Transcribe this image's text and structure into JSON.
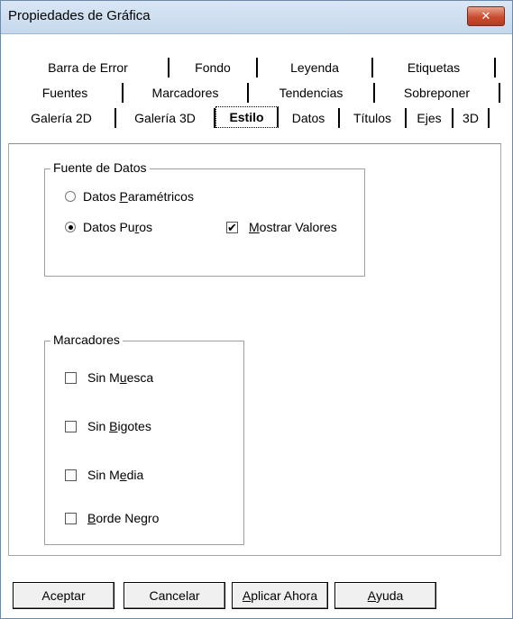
{
  "window": {
    "title": "Propiedades de Gráfica",
    "close_glyph": "✕"
  },
  "tabs": {
    "row1": [
      "Barra de Error",
      "Fondo",
      "Leyenda",
      "Etiquetas"
    ],
    "row2": [
      "Fuentes",
      "Marcadores",
      "Tendencias",
      "Sobreponer"
    ],
    "row3": [
      "Galería 2D",
      "Galería 3D",
      "Estilo",
      "Datos",
      "Títulos",
      "Ejes",
      "3D"
    ],
    "active": "Estilo"
  },
  "fuente_datos": {
    "legend": "Fuente de Datos",
    "parametricos": {
      "pre": "Datos ",
      "key": "P",
      "post": "aramétricos",
      "selected": false
    },
    "puros": {
      "pre": "Datos Pu",
      "key": "r",
      "post": "os",
      "selected": true
    },
    "mostrar_valores": {
      "pre": "",
      "key": "M",
      "post": "ostrar Valores",
      "checked": true
    }
  },
  "marcadores": {
    "legend": "Marcadores",
    "sin_muesca": {
      "pre": "Sin M",
      "key": "u",
      "post": "esca",
      "checked": false
    },
    "sin_bigotes": {
      "pre": "Sin ",
      "key": "B",
      "post": "igotes",
      "checked": false
    },
    "sin_media": {
      "pre": "Sin M",
      "key": "e",
      "post": "dia",
      "checked": false
    },
    "borde_negro": {
      "pre": "",
      "key": "B",
      "post": "orde Negro",
      "checked": false
    }
  },
  "buttons": {
    "aceptar": "Aceptar",
    "cancelar": "Cancelar",
    "aplicar": {
      "pre": "",
      "key": "A",
      "post": "plicar Ahora"
    },
    "ayuda": {
      "pre": "",
      "key": "A",
      "post": "yuda"
    }
  },
  "check_glyph": "✔"
}
